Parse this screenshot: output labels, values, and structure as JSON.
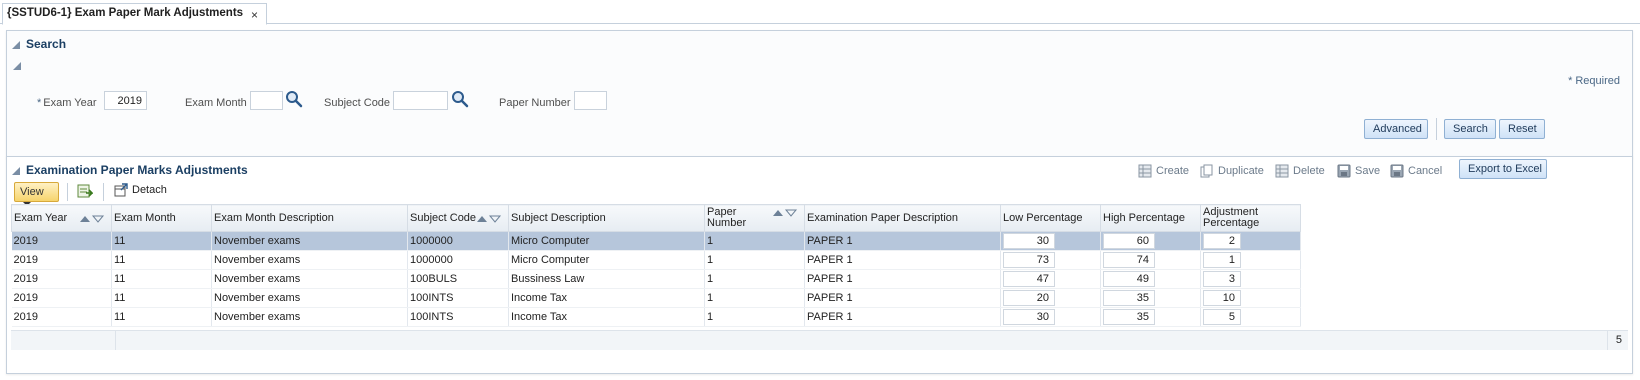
{
  "tab": {
    "title": "{SSTUD6-1} Exam Paper Mark Adjustments",
    "close": "×"
  },
  "search": {
    "title": "Search",
    "required_label": "Required",
    "required_star": "*",
    "fields": {
      "exam_year_label": "Exam Year",
      "exam_year_value": "2019",
      "exam_month_label": "Exam Month",
      "exam_month_value": "",
      "subject_code_label": "Subject Code",
      "subject_code_value": "",
      "paper_number_label": "Paper Number",
      "paper_number_value": ""
    },
    "buttons": {
      "advanced": "Advanced",
      "search": "Search",
      "reset": "Reset"
    }
  },
  "results": {
    "title": "Examination Paper Marks Adjustments",
    "toolbar": {
      "create": "Create",
      "duplicate": "Duplicate",
      "delete": "Delete",
      "save": "Save",
      "cancel": "Cancel",
      "export": "Export to Excel"
    },
    "view_label": "View",
    "detach_label": "Detach",
    "columns": {
      "exam_year": "Exam Year",
      "exam_month": "Exam Month",
      "exam_month_description": "Exam Month Description",
      "subject_code": "Subject Code",
      "subject_description": "Subject Description",
      "paper_number_1": "Paper",
      "paper_number_2": "Number",
      "exam_paper_description": "Examination Paper Description",
      "low_percentage": "Low Percentage",
      "high_percentage": "High Percentage",
      "adjustment_1": "Adjustment",
      "adjustment_2": "Percentage"
    },
    "rows": [
      {
        "year": "2019",
        "month": "11",
        "month_desc": "November exams",
        "subject_code": "1000000",
        "subject_desc": "Micro Computer",
        "paper": "1",
        "paper_desc": "PAPER 1",
        "low": "30",
        "high": "60",
        "adj": "2"
      },
      {
        "year": "2019",
        "month": "11",
        "month_desc": "November exams",
        "subject_code": "1000000",
        "subject_desc": "Micro Computer",
        "paper": "1",
        "paper_desc": "PAPER 1",
        "low": "73",
        "high": "74",
        "adj": "1"
      },
      {
        "year": "2019",
        "month": "11",
        "month_desc": "November exams",
        "subject_code": "100BULS",
        "subject_desc": "Bussiness Law",
        "paper": "1",
        "paper_desc": "PAPER 1",
        "low": "47",
        "high": "49",
        "adj": "3"
      },
      {
        "year": "2019",
        "month": "11",
        "month_desc": "November exams",
        "subject_code": "100INTS",
        "subject_desc": "Income Tax",
        "paper": "1",
        "paper_desc": "PAPER 1",
        "low": "20",
        "high": "35",
        "adj": "10"
      },
      {
        "year": "2019",
        "month": "11",
        "month_desc": "November exams",
        "subject_code": "100INTS",
        "subject_desc": "Income Tax",
        "paper": "1",
        "paper_desc": "PAPER 1",
        "low": "30",
        "high": "35",
        "adj": "5"
      }
    ],
    "row_count": "5"
  },
  "colors": {
    "accent": "#1b3f63",
    "selected_row": "#b6c6db",
    "view_button": "#f6d46d"
  }
}
